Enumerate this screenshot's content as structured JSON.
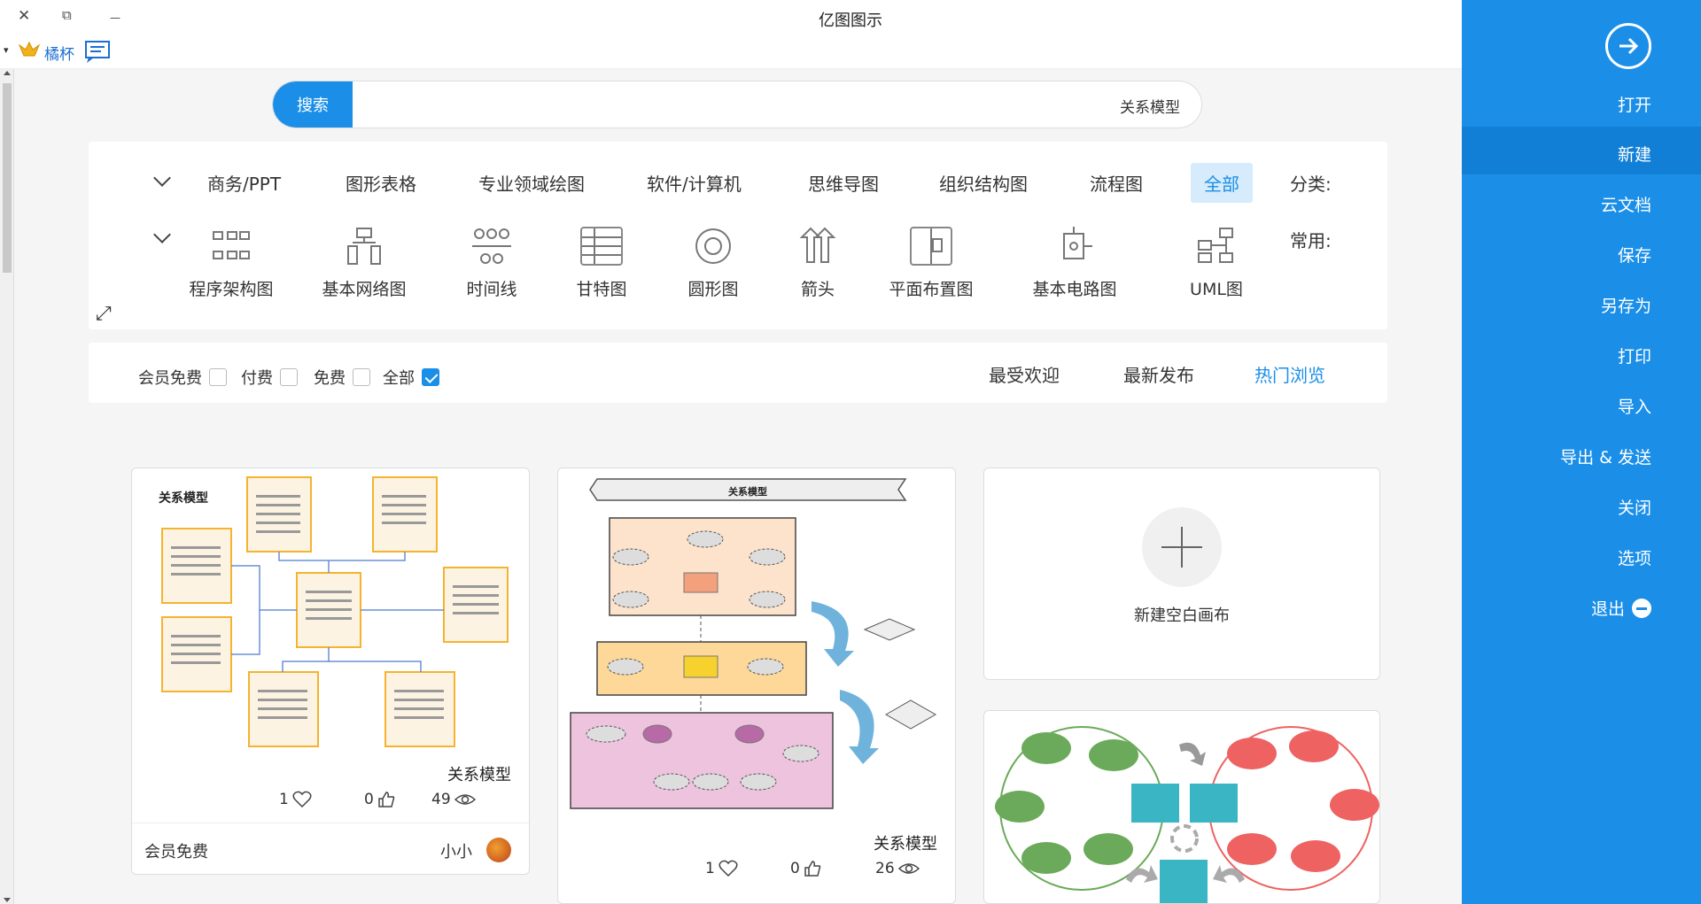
{
  "titlebar": {
    "title": "亿图图示",
    "close": "✕",
    "restore": "⧉",
    "minimize": "—"
  },
  "toolbar": {
    "user_label": "橘杯",
    "dropdown": "▾"
  },
  "sidebar": {
    "items": [
      "打开",
      "新建",
      "云文档",
      "保存",
      "另存为",
      "打印",
      "导入",
      "导出 & 发送",
      "关闭",
      "选项",
      "退出"
    ],
    "active": "新建"
  },
  "search": {
    "button": "搜索",
    "value": "关系模型"
  },
  "categories": {
    "label": "分类:",
    "items": [
      "全部",
      "流程图",
      "组织结构图",
      "思维导图",
      "软件/计算机",
      "专业领域绘图",
      "图形表格",
      "商务/PPT"
    ],
    "active": "全部"
  },
  "common": {
    "label": "常用:",
    "items": [
      "UML图",
      "基本电路图",
      "平面布置图",
      "箭头",
      "圆形图",
      "甘特图",
      "时间线",
      "基本网络图",
      "程序架构图"
    ]
  },
  "sort": {
    "tabs": [
      "热门浏览",
      "最新发布",
      "最受欢迎"
    ],
    "active": "热门浏览"
  },
  "filters": {
    "items": [
      "全部",
      "免费",
      "付费",
      "会员免费"
    ],
    "checked": "全部"
  },
  "cards": [
    {
      "name": "关系模型",
      "views": "49",
      "likes": "0",
      "favorites": "1",
      "author": "小小",
      "price": "会员免费"
    },
    {
      "name": "关系模型",
      "views": "26",
      "likes": "0",
      "favorites": "1"
    }
  ],
  "new_blank": {
    "label": "新建空白画布"
  },
  "colors": {
    "accent": "#1b8fe8",
    "sidebar_active": "#127fd6"
  }
}
